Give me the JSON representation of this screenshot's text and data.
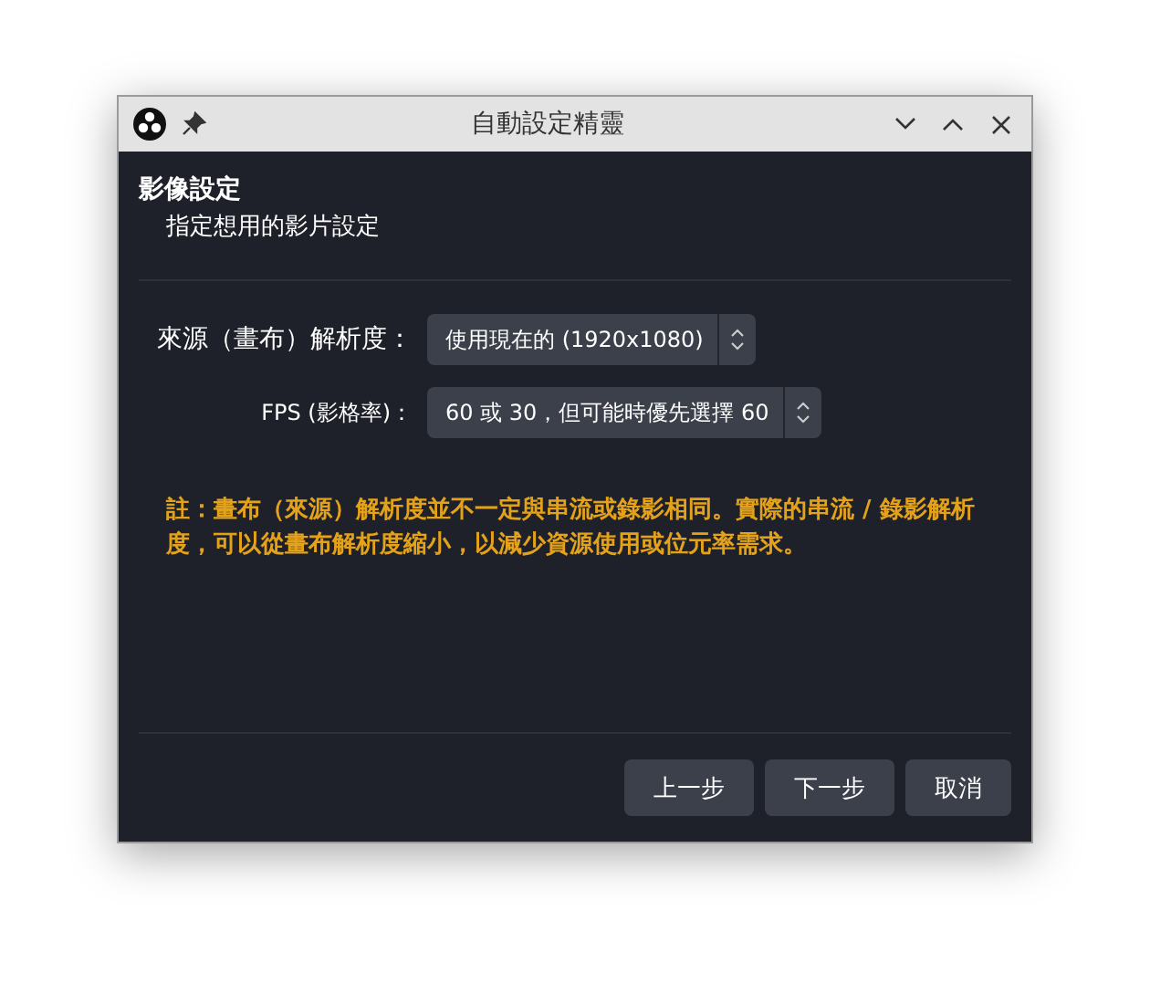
{
  "window": {
    "title": "自動設定精靈"
  },
  "header": {
    "title": "影像設定",
    "subtitle": "指定想用的影片設定"
  },
  "fields": [
    {
      "label": "來源（畫布）解析度：",
      "value": "使用現在的 (1920x1080)"
    },
    {
      "label": "FPS (影格率)：",
      "value": "60 或 30，但可能時優先選擇 60"
    }
  ],
  "note": "註：畫布（來源）解析度並不一定與串流或錄影相同。實際的串流 / 錄影解析度，可以從畫布解析度縮小，以減少資源使用或位元率需求。",
  "buttons": [
    "上一步",
    "下一步",
    "取消"
  ]
}
